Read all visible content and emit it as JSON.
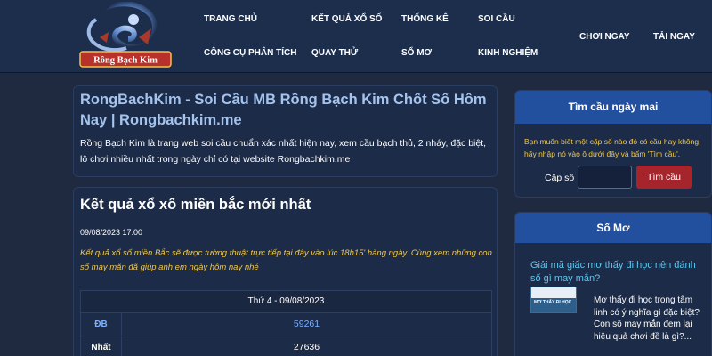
{
  "header": {
    "logo_text": "RỒNG BẠCH KIM",
    "nav": [
      {
        "label": "TRANG CHỦ"
      },
      {
        "label": "KẾT QUẢ XỔ SỐ"
      },
      {
        "label": "THỐNG KÊ"
      },
      {
        "label": "SOI CẦU"
      },
      {
        "label": "CÔNG CỤ PHÂN TÍCH"
      },
      {
        "label": "QUAY THỬ"
      },
      {
        "label": "SỔ MƠ"
      },
      {
        "label": "KINH NGHIỆM"
      }
    ],
    "right_nav": [
      {
        "label": "CHƠI NGAY"
      },
      {
        "label": "TẢI NGAY"
      }
    ]
  },
  "intro": {
    "title": "RongBachKim - Soi Cầu MB Rồng Bạch Kim Chốt Số Hôm Nay | Rongbachkim.me",
    "text": "Rồng Bạch Kim là trang web soi cầu chuẩn xác nhất hiện nay, xem cầu bạch thủ, 2 nháy, đặc biệt, lô chơi nhiều nhất trong ngày chỉ có tại website Rongbachkim.me"
  },
  "results": {
    "title": "Kết quả xổ xố miền bắc mới nhất",
    "datetime": "09/08/2023 17:00",
    "note": "Kết quả xổ số miền Bắc sẽ được tường thuật trực tiếp tại đây vào lúc 18h15' hàng ngày. Cùng xem những con số may mắn đã giúp anh em ngày hôm nay nhé",
    "table_header": "Thứ 4 - 09/08/2023",
    "rows": [
      {
        "label": "ĐB",
        "value": "59261"
      },
      {
        "label": "Nhất",
        "value": "27636"
      }
    ]
  },
  "sidebar": {
    "find": {
      "title": "Tìm cầu ngày mai",
      "description": "Bạn muốn biết một cặp số nào đó có cầu hay không, hãy nhập nó vào ô dưới đây và bấm 'Tìm cầu'.",
      "label": "Cặp số",
      "input_value": "",
      "input_placeholder": "",
      "button_label": "Tìm cầu"
    },
    "somo": {
      "title": "Sổ Mơ",
      "article_title": "Giải mã giấc mơ thấy đi học nên đánh số gì may mắn?",
      "thumbnail_caption": "MƠ THẤY ĐI HỌC",
      "article_text": "Mơ thấy đi học trong tâm linh có ý nghĩa gì đặc biệt? Con số may mắn đem lại hiệu quả chơi đề là gì?..."
    }
  },
  "colors": {
    "background": "#1f2940",
    "header": "#1d2e4d",
    "panel": "#1c2b47",
    "sidebar_head": "#224f9e",
    "accent_link": "#a4c4ee",
    "note_yellow": "#f2c94c",
    "db_blue": "#7fb0ff",
    "button_red": "#a6252d",
    "somo_link": "#5fc5ee"
  }
}
